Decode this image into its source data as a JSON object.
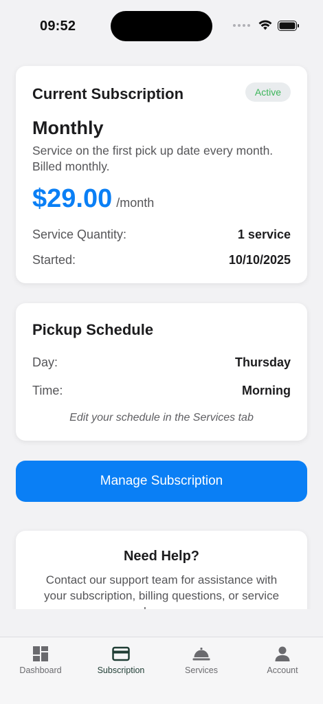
{
  "status_bar": {
    "time": "09:52"
  },
  "subscription": {
    "title": "Current Subscription",
    "status": "Active",
    "plan_name": "Monthly",
    "description": "Service on the first pick up date every month. Billed monthly.",
    "price": "$29.00",
    "period": "/month",
    "quantity_label": "Service Quantity:",
    "quantity_value": "1 service",
    "started_label": "Started:",
    "started_value": "10/10/2025"
  },
  "schedule": {
    "title": "Pickup Schedule",
    "day_label": "Day:",
    "day_value": "Thursday",
    "time_label": "Time:",
    "time_value": "Morning",
    "note": "Edit your schedule in the Services tab"
  },
  "manage_button": {
    "label": "Manage Subscription"
  },
  "help": {
    "title": "Need Help?",
    "text": "Contact our support team for assistance with your subscription, billing questions, or service changes."
  },
  "tab_bar": {
    "active": "Subscription",
    "tabs": [
      {
        "label": "Dashboard",
        "icon": "dashboard-icon"
      },
      {
        "label": "Subscription",
        "icon": "credit-card-icon"
      },
      {
        "label": "Services",
        "icon": "service-bell-icon"
      },
      {
        "label": "Account",
        "icon": "person-icon"
      }
    ]
  },
  "colors": {
    "accent": "#0a7ff5",
    "active_badge_text": "#3cb55a",
    "active_tab": "#1f3d34"
  }
}
